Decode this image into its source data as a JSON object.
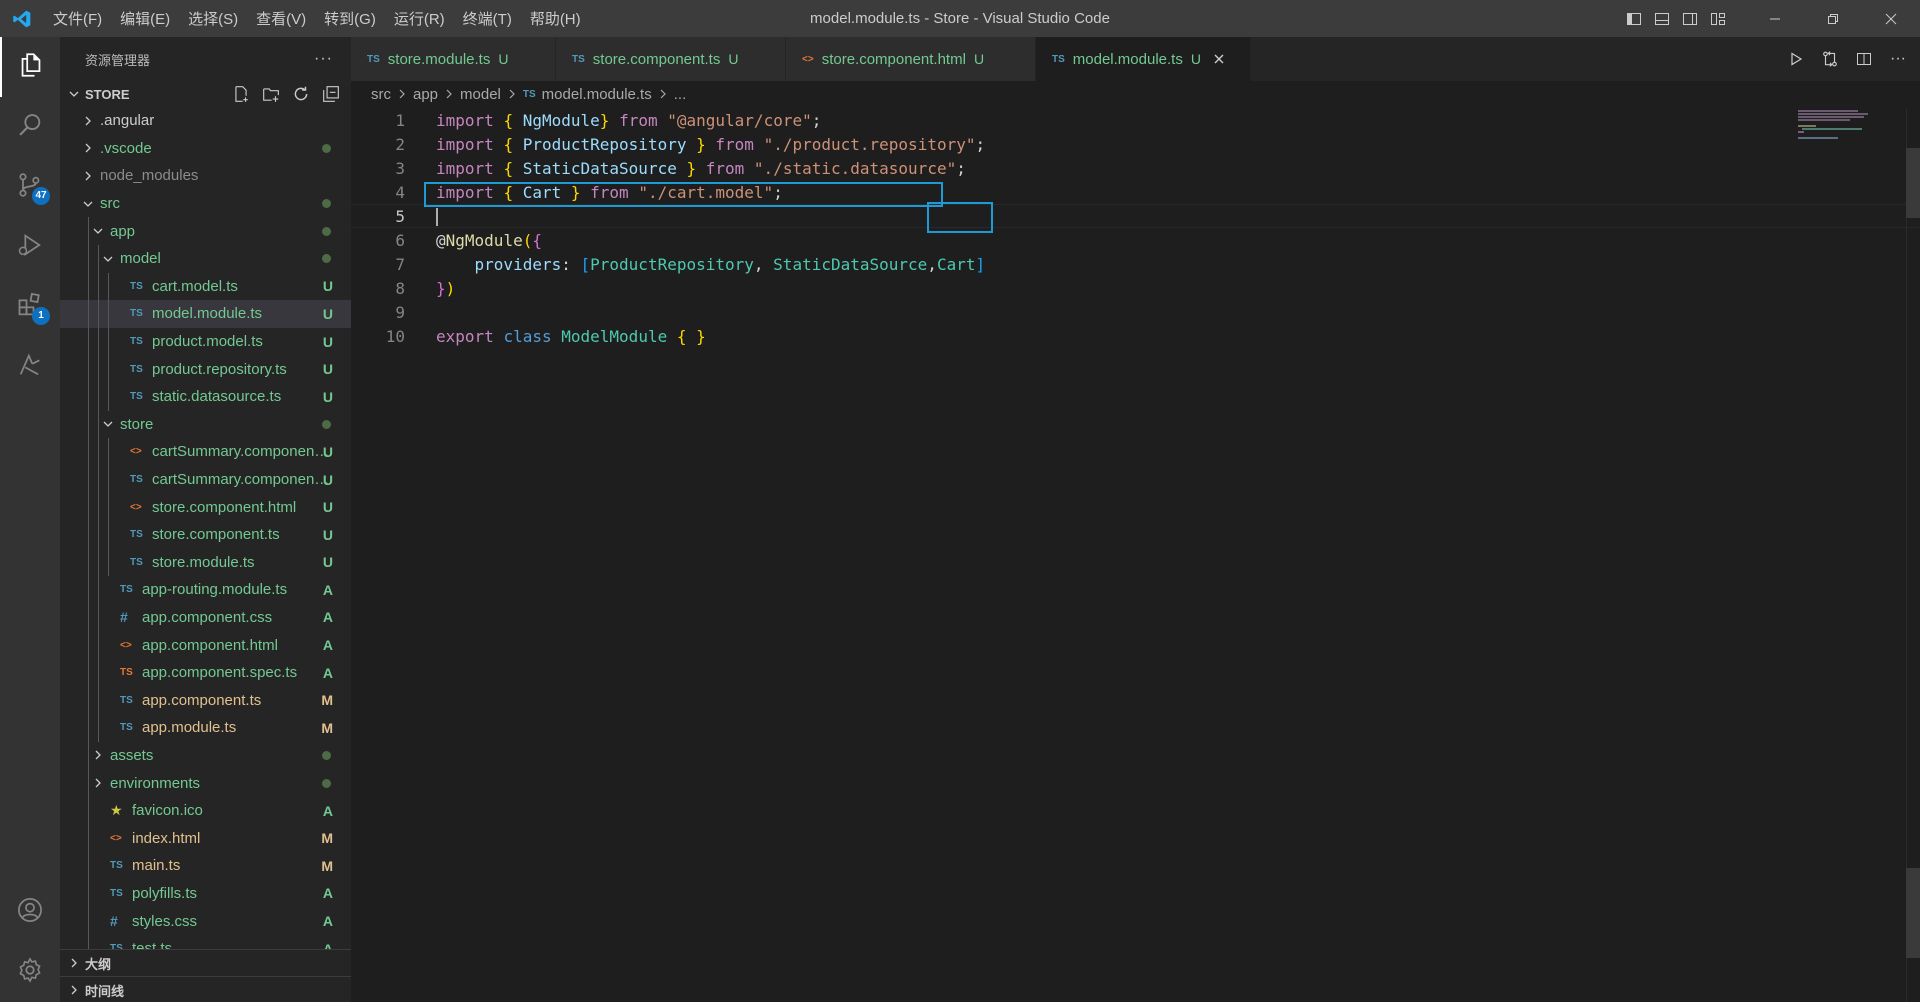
{
  "window": {
    "title": "model.module.ts - Store - Visual Studio Code",
    "menu": [
      "文件(F)",
      "编辑(E)",
      "选择(S)",
      "查看(V)",
      "转到(G)",
      "运行(R)",
      "终端(T)",
      "帮助(H)"
    ]
  },
  "activity_bar": {
    "items": [
      {
        "icon": "files-icon",
        "badge": ""
      },
      {
        "icon": "search-icon",
        "badge": ""
      },
      {
        "icon": "source-control-icon",
        "badge": "47"
      },
      {
        "icon": "run-debug-icon",
        "badge": ""
      },
      {
        "icon": "extensions-icon",
        "badge": "1"
      },
      {
        "icon": "remote-icon",
        "badge": ""
      }
    ],
    "bottom": [
      {
        "icon": "account-icon"
      },
      {
        "icon": "settings-gear-icon"
      }
    ]
  },
  "sidebar": {
    "title": "资源管理器",
    "more": "···",
    "section": "STORE",
    "outline": "大纲",
    "timeline": "时间线",
    "tree": [
      {
        "name": ".angular",
        "type": "folder",
        "depth": 1,
        "open": false,
        "status": "",
        "dot": false
      },
      {
        "name": ".vscode",
        "type": "folder",
        "depth": 1,
        "open": false,
        "status": "",
        "dot": true
      },
      {
        "name": "node_modules",
        "type": "folder",
        "depth": 1,
        "open": false,
        "status": "",
        "dot": false,
        "dim": true
      },
      {
        "name": "src",
        "type": "folder",
        "depth": 1,
        "open": true,
        "status": "",
        "dot": true
      },
      {
        "name": "app",
        "type": "folder",
        "depth": 2,
        "open": true,
        "status": "",
        "dot": true
      },
      {
        "name": "model",
        "type": "folder",
        "depth": 3,
        "open": true,
        "status": "",
        "dot": true
      },
      {
        "name": "cart.model.ts",
        "type": "ts",
        "depth": 4,
        "status": "U"
      },
      {
        "name": "model.module.ts",
        "type": "ts",
        "depth": 4,
        "status": "U",
        "selected": true
      },
      {
        "name": "product.model.ts",
        "type": "ts",
        "depth": 4,
        "status": "U"
      },
      {
        "name": "product.repository.ts",
        "type": "ts",
        "depth": 4,
        "status": "U"
      },
      {
        "name": "static.datasource.ts",
        "type": "ts",
        "depth": 4,
        "status": "U"
      },
      {
        "name": "store",
        "type": "folder",
        "depth": 3,
        "open": true,
        "status": "",
        "dot": true
      },
      {
        "name": "cartSummary.component.html",
        "type": "html",
        "depth": 4,
        "status": "U"
      },
      {
        "name": "cartSummary.component.ts",
        "type": "ts",
        "depth": 4,
        "status": "U"
      },
      {
        "name": "store.component.html",
        "type": "html",
        "depth": 4,
        "status": "U"
      },
      {
        "name": "store.component.ts",
        "type": "ts",
        "depth": 4,
        "status": "U"
      },
      {
        "name": "store.module.ts",
        "type": "ts",
        "depth": 4,
        "status": "U"
      },
      {
        "name": "app-routing.module.ts",
        "type": "ts",
        "depth": 3,
        "status": "A"
      },
      {
        "name": "app.component.css",
        "type": "css",
        "depth": 3,
        "status": "A"
      },
      {
        "name": "app.component.html",
        "type": "html",
        "depth": 3,
        "status": "A"
      },
      {
        "name": "app.component.spec.ts",
        "type": "spec",
        "depth": 3,
        "status": "A"
      },
      {
        "name": "app.component.ts",
        "type": "ts",
        "depth": 3,
        "status": "M"
      },
      {
        "name": "app.module.ts",
        "type": "ts",
        "depth": 3,
        "status": "M"
      },
      {
        "name": "assets",
        "type": "folder",
        "depth": 2,
        "open": false,
        "status": "",
        "dot": true
      },
      {
        "name": "environments",
        "type": "folder",
        "depth": 2,
        "open": false,
        "status": "",
        "dot": true
      },
      {
        "name": "favicon.ico",
        "type": "star",
        "depth": 2,
        "status": "A"
      },
      {
        "name": "index.html",
        "type": "html",
        "depth": 2,
        "status": "M"
      },
      {
        "name": "main.ts",
        "type": "ts",
        "depth": 2,
        "status": "M"
      },
      {
        "name": "polyfills.ts",
        "type": "ts",
        "depth": 2,
        "status": "A"
      },
      {
        "name": "styles.css",
        "type": "css",
        "depth": 2,
        "status": "A"
      },
      {
        "name": "test.ts",
        "type": "ts",
        "depth": 2,
        "status": "A"
      }
    ]
  },
  "tabs": [
    {
      "label": "store.module.ts",
      "icon": "TS",
      "type": "ts",
      "status": "U",
      "active": false
    },
    {
      "label": "store.component.ts",
      "icon": "TS",
      "type": "ts",
      "status": "U",
      "active": false
    },
    {
      "label": "store.component.html",
      "icon": "<>",
      "type": "html",
      "status": "U",
      "active": false
    },
    {
      "label": "model.module.ts",
      "icon": "TS",
      "type": "ts",
      "status": "U",
      "active": true
    }
  ],
  "breadcrumb": [
    "src",
    "app",
    "model",
    "model.module.ts",
    "..."
  ],
  "code": {
    "current_line": 5,
    "lines": [
      [
        [
          "import",
          "kw"
        ],
        [
          " ",
          "pl"
        ],
        [
          "{",
          "br"
        ],
        [
          " NgModule",
          "id"
        ],
        [
          "}",
          "br"
        ],
        [
          " ",
          "pl"
        ],
        [
          "from",
          "kw"
        ],
        [
          " ",
          "pl"
        ],
        [
          "\"@angular/core\"",
          "str"
        ],
        [
          ";",
          "pl"
        ]
      ],
      [
        [
          "import",
          "kw"
        ],
        [
          " ",
          "pl"
        ],
        [
          "{",
          "br"
        ],
        [
          " ProductRepository ",
          "id"
        ],
        [
          "}",
          "br"
        ],
        [
          " ",
          "pl"
        ],
        [
          "from",
          "kw"
        ],
        [
          " ",
          "pl"
        ],
        [
          "\"./product.repository\"",
          "str"
        ],
        [
          ";",
          "pl"
        ]
      ],
      [
        [
          "import",
          "kw"
        ],
        [
          " ",
          "pl"
        ],
        [
          "{",
          "br"
        ],
        [
          " StaticDataSource ",
          "id"
        ],
        [
          "}",
          "br"
        ],
        [
          " ",
          "pl"
        ],
        [
          "from",
          "kw"
        ],
        [
          " ",
          "pl"
        ],
        [
          "\"./static.datasource\"",
          "str"
        ],
        [
          ";",
          "pl"
        ]
      ],
      [
        [
          "import",
          "kw"
        ],
        [
          " ",
          "pl"
        ],
        [
          "{",
          "br"
        ],
        [
          " Cart ",
          "id"
        ],
        [
          "}",
          "br"
        ],
        [
          " ",
          "pl"
        ],
        [
          "from",
          "kw"
        ],
        [
          " ",
          "pl"
        ],
        [
          "\"./cart.model\"",
          "str"
        ],
        [
          ";",
          "pl"
        ]
      ],
      [],
      [
        [
          "@",
          "pl"
        ],
        [
          "NgModule",
          "fn"
        ],
        [
          "(",
          "br"
        ],
        [
          "{",
          "br2"
        ]
      ],
      [
        [
          "    providers",
          "id"
        ],
        [
          ": ",
          "pl"
        ],
        [
          "[",
          "br3"
        ],
        [
          "ProductRepository",
          "cls"
        ],
        [
          ", ",
          "pl"
        ],
        [
          "StaticDataSource",
          "cls"
        ],
        [
          ",",
          "pl"
        ],
        [
          "Cart",
          "cls"
        ],
        [
          "]",
          "br3"
        ]
      ],
      [
        [
          "}",
          "br2"
        ],
        [
          ")",
          "br"
        ]
      ],
      [],
      [
        [
          "export",
          "kw"
        ],
        [
          " ",
          "pl"
        ],
        [
          "class",
          "kw2"
        ],
        [
          " ",
          "pl"
        ],
        [
          "ModelModule",
          "cls"
        ],
        [
          " ",
          "pl"
        ],
        [
          "{",
          "br"
        ],
        [
          " ",
          "pl"
        ],
        [
          "}",
          "br"
        ]
      ]
    ]
  },
  "colors": {
    "accent": "#1e9bd7",
    "untracked": "#73c991",
    "modified": "#e2c08d",
    "ts_icon": "#519aba",
    "html_icon": "#e37933",
    "css_icon": "#519aba",
    "spec_icon": "#e37933",
    "star_icon": "#cbcb41"
  }
}
